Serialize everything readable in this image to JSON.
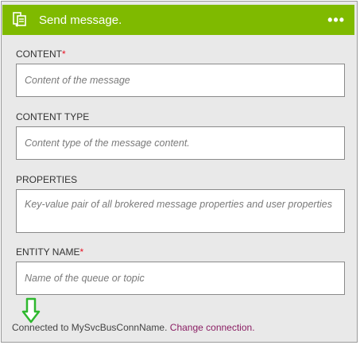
{
  "header": {
    "title": "Send message.",
    "more_label": "•••",
    "accent_color": "#7fba00"
  },
  "fields": [
    {
      "label": "CONTENT",
      "required": "*",
      "placeholder": "Content of the message"
    },
    {
      "label": "CONTENT TYPE",
      "required": "",
      "placeholder": "Content type of the message content."
    },
    {
      "label": "PROPERTIES",
      "required": "",
      "placeholder": "Key-value pair of all brokered message properties and user properties"
    },
    {
      "label": "ENTITY NAME",
      "required": "*",
      "placeholder": "Name of the queue or topic"
    }
  ],
  "footer": {
    "connected_text": "Connected to MySvcBusConnName.",
    "change_link": "Change connection."
  },
  "annotation": {
    "icon": "down-arrow-icon",
    "color": "#2eb82e"
  }
}
